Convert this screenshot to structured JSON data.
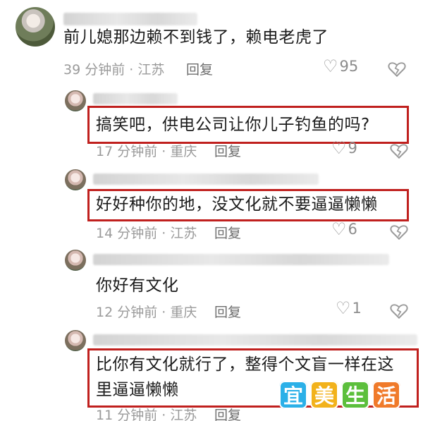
{
  "comments": [
    {
      "text": "前儿媳那边赖不到钱了，赖电老虎了",
      "time": "39 分钟前 · 江苏",
      "reply_label": "回复",
      "likes": "95",
      "highlighted": false
    },
    {
      "text": "搞笑吧，供电公司让你儿子钓鱼的吗?",
      "time": "17 分钟前 · 重庆",
      "reply_label": "回复",
      "likes": "9",
      "highlighted": true
    },
    {
      "text": "好好种你的地，没文化就不要逼逼懒懒",
      "time": "14 分钟前 · 江苏",
      "reply_label": "回复",
      "likes": "6",
      "highlighted": true
    },
    {
      "text": "你好有文化",
      "time": "12 分钟前 · 重庆",
      "reply_label": "回复",
      "likes": "1",
      "highlighted": false
    },
    {
      "text_line1": "比你有文化就行了，整得个文盲一样在这",
      "text_line2": "里逼逼懒懒",
      "time": "11 分钟前 · 江苏",
      "reply_label": "回复",
      "highlighted": true
    }
  ],
  "watermark": {
    "chars": [
      "宜",
      "美",
      "生",
      "活"
    ],
    "colors": [
      "#2bb0e8",
      "#f2b21b",
      "#5cbf3c",
      "#f07a2a"
    ]
  },
  "icons": {
    "like": "heart-outline-icon",
    "dislike": "broken-heart-icon"
  },
  "colors": {
    "highlight_border": "#c0201e",
    "meta_text": "#9a9a9a"
  }
}
